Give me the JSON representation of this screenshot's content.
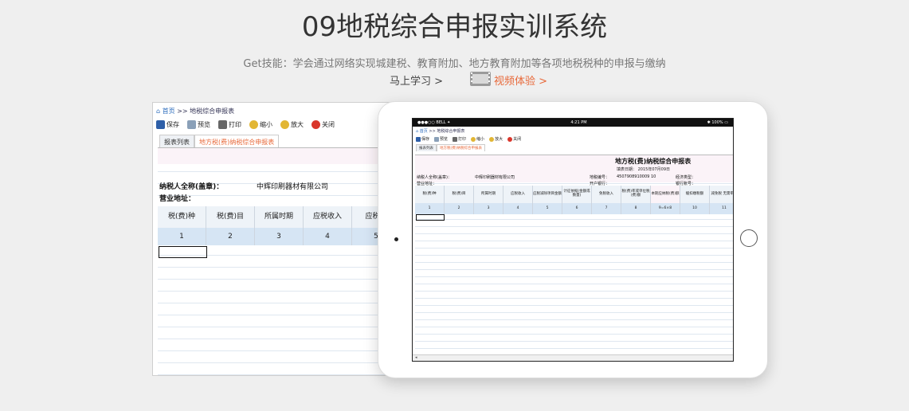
{
  "hero": {
    "title": "09地税综合申报实训系统",
    "description": "Get技能：学会通过网络实现城建税、教育附加、地方教育附加等各项地税税种的申报与缴纳",
    "learn_label": "马上学习 >",
    "video_label": "视频体验 >"
  },
  "desktop": {
    "breadcrumb_home": "首页",
    "breadcrumb_rest": ">> 地税综合申报表",
    "toolbar": [
      "保存",
      "预览",
      "打印",
      "缩小",
      "放大",
      "关闭"
    ],
    "tabs": [
      "报表列表",
      "地方税(费)纳税综合申报表"
    ],
    "taxpayer_label": "纳税人全称(盖章)：",
    "taxpayer_value": "中辉印刷器材有限公司",
    "address_label": "营业地址：",
    "columns": [
      "税(费)种",
      "税(费)目",
      "所属时期",
      "应税收入",
      "应税减"
    ],
    "col_numbers": [
      "1",
      "2",
      "3",
      "4",
      "5"
    ]
  },
  "tablet": {
    "status_left": "●●●○○ BELL ✦",
    "status_time": "4:21 PM",
    "status_right": "✱ 100% ▭",
    "breadcrumb_home": "首页",
    "breadcrumb_rest": ">> 地税综合申报表",
    "toolbar": [
      "保存",
      "预览",
      "打印",
      "缩小",
      "放大",
      "关闭"
    ],
    "tabs": [
      "报表列表",
      "地方税(费)纳税综合申报表"
    ],
    "form_title": "地方税(费)纳税综合申报表",
    "fill_date": "填表日期：   2015年07月09日",
    "taxpayer_label": "纳税人全称(盖章)：",
    "taxpayer_value": "中辉印刷器材有限公司",
    "tax_code_label": "地税编号：",
    "tax_code_value": "4507908910009 10",
    "econ_type_label": "经济类型：",
    "address_label": "营业地址：",
    "bank_label": "开户银行：",
    "account_label": "银行账号：",
    "columns": [
      "税(费)种",
      "税(费)目",
      "所属时期",
      "应税收入",
      "应税减除项目金额",
      "计征依据(金额或数量)",
      "免税收入",
      "税(费)率或单位税(费)额",
      "本期应纳税(费)额",
      "缓扣缴税额",
      "减免税 无需审批"
    ],
    "col_numbers": [
      "1",
      "2",
      "3",
      "4",
      "5",
      "6",
      "7",
      "8",
      "9=6×8",
      "10",
      "11"
    ],
    "scroll_label": "◂"
  },
  "colors": {
    "accent": "#e8693a",
    "link": "#2f6ebd",
    "header_blue": "#d6e5f4",
    "pink_band": "#fbf3f8"
  }
}
